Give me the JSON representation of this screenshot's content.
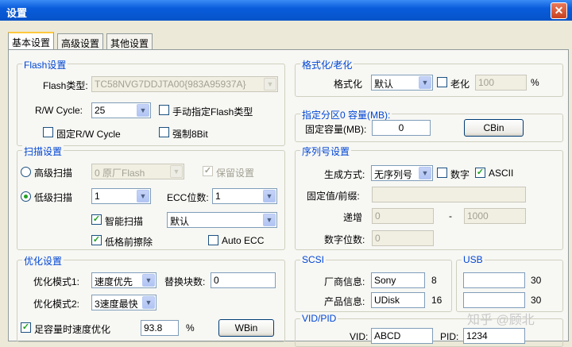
{
  "window": {
    "title": "设置",
    "close_glyph": "✕"
  },
  "tabs": [
    "基本设置",
    "高级设置",
    "其他设置"
  ],
  "flash": {
    "legend": "Flash设置",
    "type_label": "Flash类型:",
    "type_value": "TC58NVG7DDJTA00{983A95937A}",
    "rw_label": "R/W Cycle:",
    "rw_value": "25",
    "manual_label": "手动指定Flash类型",
    "fixed_rw_label": "固定R/W Cycle",
    "force8_label": "强制8Bit"
  },
  "scan": {
    "legend": "扫描设置",
    "high_label": "高级扫描",
    "high_value": "0 原厂Flash",
    "keep_label": "保留设置",
    "keep_check": "✓",
    "low_label": "低级扫描",
    "low_value": "1",
    "ecc_label": "ECC位数:",
    "ecc_value": "1",
    "smart_label": "智能扫描",
    "smart_check": "✓",
    "smart_value": "默认",
    "lowerase_label": "低格前擦除",
    "lowerase_check": "✓",
    "autoecc_label": "Auto ECC"
  },
  "opt": {
    "legend": "优化设置",
    "mode1_label": "优化模式1:",
    "mode1_value": "速度优先",
    "swap_label": "替换块数:",
    "swap_value": "0",
    "mode2_label": "优化模式2:",
    "mode2_value": "3速度最快",
    "full_label": "足容量时速度优化",
    "full_check": "✓",
    "full_value": "93.8",
    "full_unit": "%",
    "wbin_label": "WBin"
  },
  "format": {
    "legend": "格式化/老化",
    "fmt_label": "格式化",
    "fmt_value": "默认",
    "age_label": "老化",
    "age_value": "100",
    "age_unit": "%"
  },
  "partition": {
    "legend": "指定分区0 容量(MB):",
    "fixed_label": "固定容量(MB):",
    "fixed_value": "0",
    "cbin_label": "CBin"
  },
  "serial": {
    "legend": "序列号设置",
    "gen_label": "生成方式:",
    "gen_value": "无序列号",
    "digit_label": "数字",
    "ascii_label": "ASCII",
    "ascii_check": "✓",
    "prefix_label": "固定值/前缀:",
    "inc_label": "递增",
    "inc_from": "0",
    "inc_dash": "-",
    "inc_to": "1000",
    "digits_label": "数字位数:",
    "digits_value": "0"
  },
  "scsi": {
    "legend": "SCSI",
    "vendor_label": "厂商信息:",
    "vendor_value": "Sony",
    "vendor_len": "8",
    "product_label": "产品信息:",
    "product_value": "UDisk",
    "product_len": "16"
  },
  "usb": {
    "legend": "USB",
    "len1": "30",
    "len2": "30"
  },
  "vidpid": {
    "legend": "VID/PID",
    "vid_label": "VID:",
    "vid_value": "ABCD",
    "pid_label": "PID:",
    "pid_value": "1234"
  },
  "watermark": "知乎 @顾北",
  "icons": {
    "dropdown": "▼",
    "close": "close-icon"
  }
}
